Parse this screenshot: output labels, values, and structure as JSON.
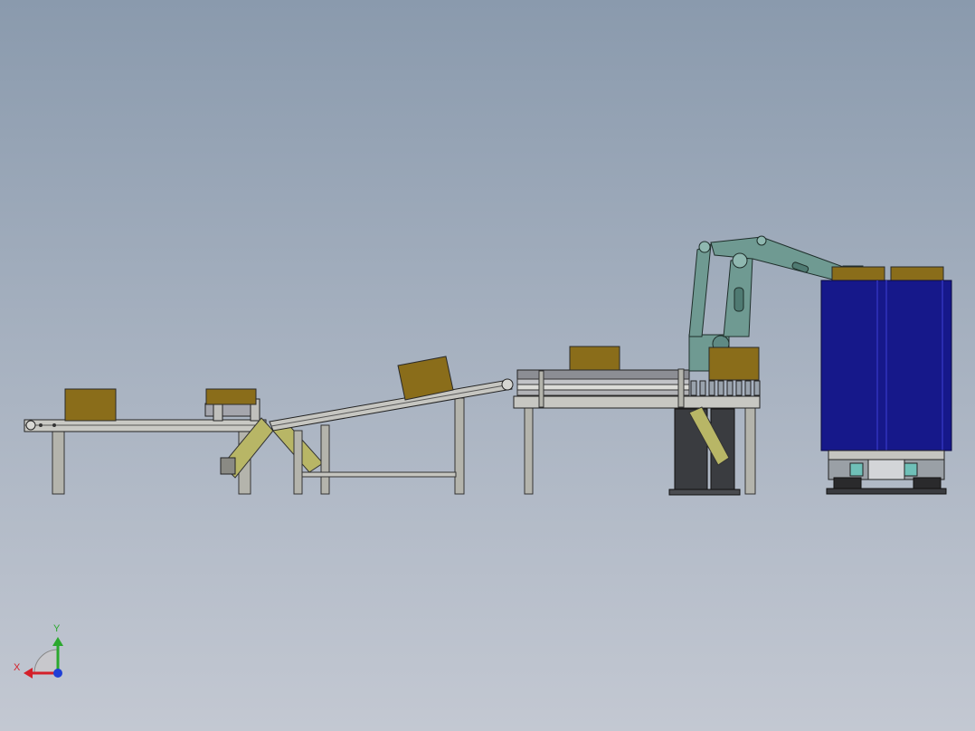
{
  "colors": {
    "viewport_top": "#8a9aad",
    "viewport_bottom": "#c3c8d2",
    "box": "#8a6d1a",
    "frame": "#b4b4ac",
    "belt": "#8c8e94",
    "diagonal_brace": "#b8b666",
    "robot": "#6f9a92",
    "pallet_stack": "#16188a",
    "dark_base": "#3a3c40",
    "axis_x": "#d4202a",
    "axis_y": "#2ba82e",
    "axis_z": "#1f3fd6"
  },
  "icons": {
    "orientation_triad": "xyz-triad-icon"
  },
  "triad": {
    "x_label": "X",
    "y_label": "Y"
  }
}
